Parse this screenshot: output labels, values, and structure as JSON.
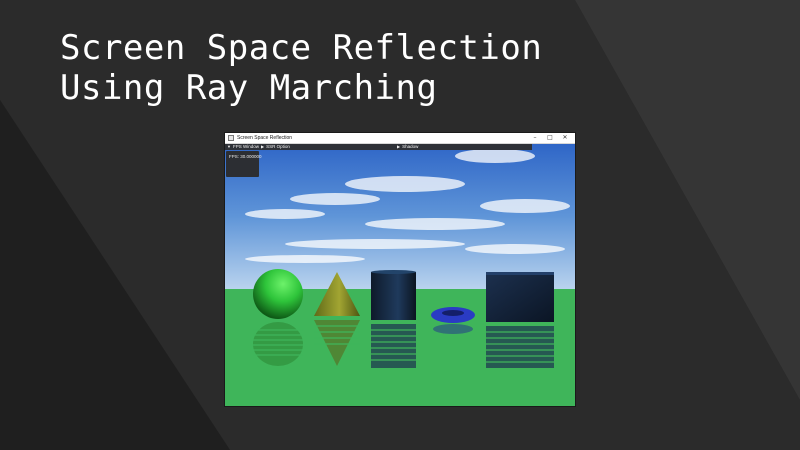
{
  "slide": {
    "title_line1": "Screen Space Reflection",
    "title_line2": "Using Ray Marching"
  },
  "window": {
    "title": "Screen Space Reflection",
    "minimize_glyph": "–",
    "maximize_glyph": "□",
    "close_glyph": "✕",
    "menu": [
      {
        "label": "FPS Window",
        "expanded": true
      },
      {
        "label": "SSR Option",
        "expanded": false
      },
      {
        "label": "Shadow",
        "expanded": false
      }
    ],
    "fps_text": "FPS: 30.000000"
  },
  "colors": {
    "background": "#262626",
    "ground": "#3fb55a",
    "sky_top": "#2f66c7",
    "sphere": "#2ec43a",
    "cone": "#7f8a26",
    "cylinder": "#152a44",
    "torus": "#2a3bc4",
    "cube": "#142238"
  },
  "icons": {
    "app": "app-window-icon",
    "expanded": "triangle-down-icon",
    "collapsed": "triangle-right-icon"
  }
}
